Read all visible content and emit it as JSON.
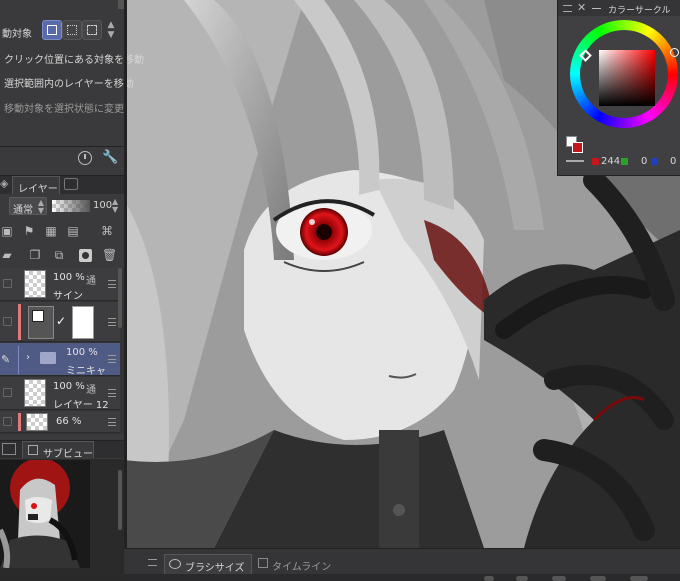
{
  "tool_property": {
    "move_target_label": "動対象",
    "option1": "クリック位置にある対象を移動",
    "option2": "選択範囲内のレイヤーを移動",
    "option3": "移動対象を選択状態に変更"
  },
  "layer_panel": {
    "tab_label": "レイヤー",
    "blend_mode": "通常",
    "opacity": "100",
    "layers": [
      {
        "percent": "100 %",
        "mode": "通",
        "name": "サイン"
      },
      {
        "percent": "",
        "mode": "",
        "name": ""
      },
      {
        "percent": "100 %",
        "mode": "",
        "name": "ミニキャ"
      },
      {
        "percent": "100 %",
        "mode": "通",
        "name": "レイヤー 12"
      },
      {
        "percent": "66 %",
        "mode": "",
        "name": ""
      }
    ]
  },
  "subview": {
    "tab_label": "サブビュー"
  },
  "color_panel": {
    "title": "カラーサークル",
    "r": "244",
    "g": "0",
    "b": "0"
  },
  "bottom_bar": {
    "brush_size_tab": "ブラシサイズ",
    "timeline_tab": "タイムライン"
  },
  "colors": {
    "accent_red": "#c4161c",
    "panel_bg": "#3a3a3c",
    "selected_layer": "#4f5a85"
  }
}
